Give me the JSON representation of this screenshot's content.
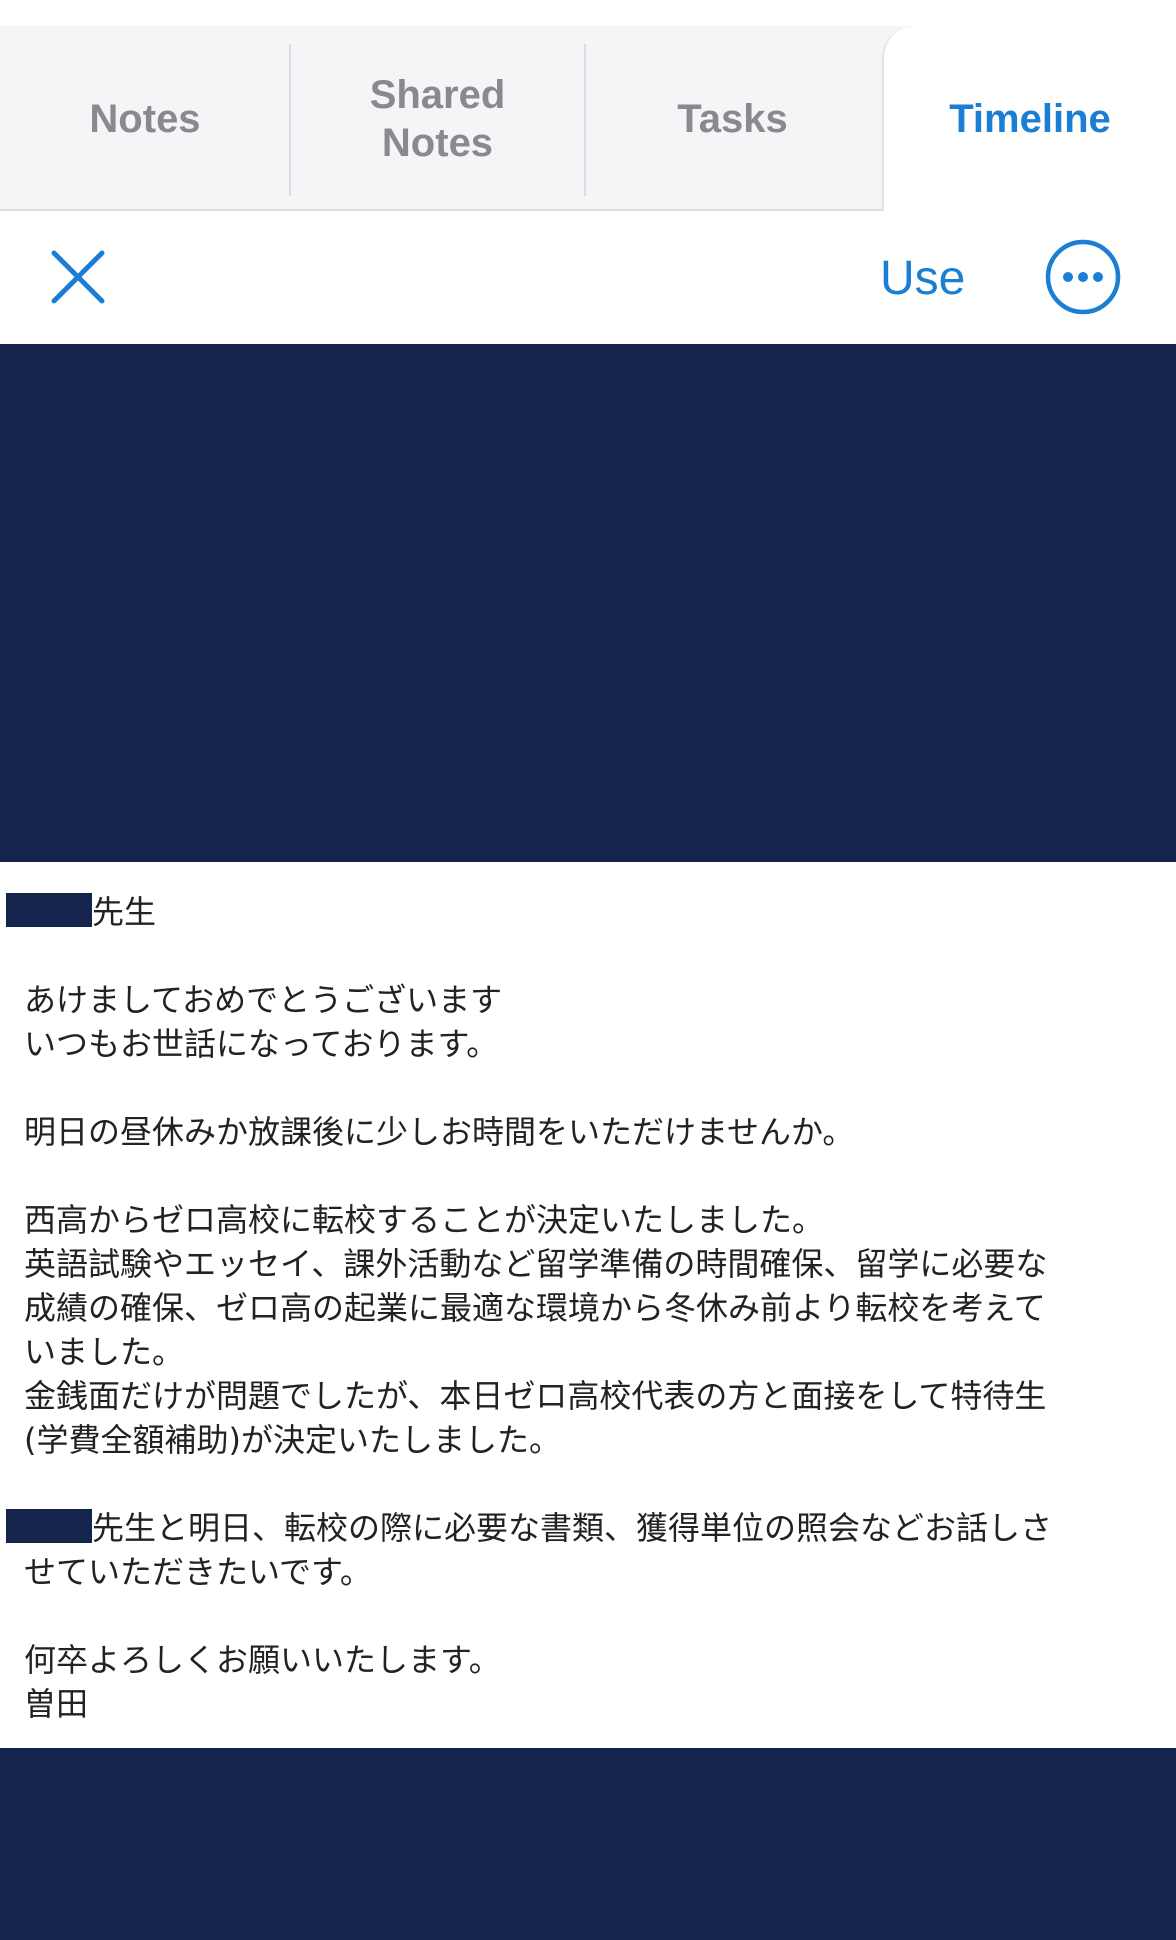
{
  "tabs": [
    {
      "label": "Notes"
    },
    {
      "label": "Shared\nNotes"
    },
    {
      "label": "Tasks"
    },
    {
      "label": "Timeline",
      "active": true
    }
  ],
  "toolbar": {
    "close_icon": "close-icon",
    "use_label": "Use",
    "more_icon": "more-options-icon"
  },
  "colors": {
    "accent": "#1a7fd4",
    "banner": "#15244d",
    "redaction": "#15244d"
  },
  "message": {
    "salutation_suffix": "先生",
    "lines": [
      "あけましておめでとうございます",
      "いつもお世話になっております。",
      "明日の昼休みか放課後に少しお時間をいただけませんか。",
      "西高からゼロ高校に転校することが決定いたしました。",
      "英語試験やエッセイ、課外活動など留学準備の時間確保、留学に必要な",
      "成績の確保、ゼロ高の起業に最適な環境から冬休み前より転校を考えて",
      "いました。",
      "金銭面だけが問題でしたが、本日ゼロ高校代表の方と面接をして特待生",
      "(学費全額補助)が決定いたしました。",
      "先生と明日、転校の際に必要な書類、獲得単位の照会などお話しさ",
      "せていただきたいです。",
      "何卒よろしくお願いいたします。",
      "曽田"
    ]
  }
}
